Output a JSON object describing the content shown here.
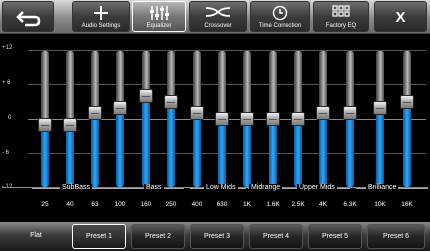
{
  "toolbar": {
    "back_icon": "back-arrow-icon",
    "tabs": [
      {
        "label": "Audio Settings",
        "icon": "plus-icon"
      },
      {
        "label": "Equalizer",
        "icon": "equalizer-sliders-icon",
        "selected": true
      },
      {
        "label": "Crossover",
        "icon": "crossover-curve-icon"
      },
      {
        "label": "Time Correction",
        "icon": "clock-icon"
      },
      {
        "label": "Factory EQ",
        "icon": "grid-icon"
      }
    ],
    "close_label": "X"
  },
  "eq": {
    "y_labels": [
      "+12",
      "+ 6",
      "0",
      "- 6",
      "- 12"
    ],
    "groups": [
      "SubBass",
      "Bass",
      "Low Mids",
      "Midrange",
      "Upper Mids",
      "Brilliance"
    ],
    "frequencies": [
      "25",
      "40",
      "63",
      "100",
      "160",
      "250",
      "400",
      "630",
      "1K",
      "1.6K",
      "2.5K",
      "4K",
      "6.3K",
      "10K",
      "16K"
    ],
    "levels_db": [
      -1,
      -1,
      1,
      2,
      4,
      3,
      1,
      0,
      0,
      0,
      0,
      1,
      1,
      2,
      3
    ]
  },
  "presets": {
    "flat_label": "Flat",
    "buttons": [
      "Preset 1",
      "Preset 2",
      "Preset 3",
      "Preset 4",
      "Preset 5",
      "Preset 6"
    ],
    "selected_index": 0
  },
  "colors": {
    "accent": "#2aa8ff",
    "background": "#000000"
  }
}
